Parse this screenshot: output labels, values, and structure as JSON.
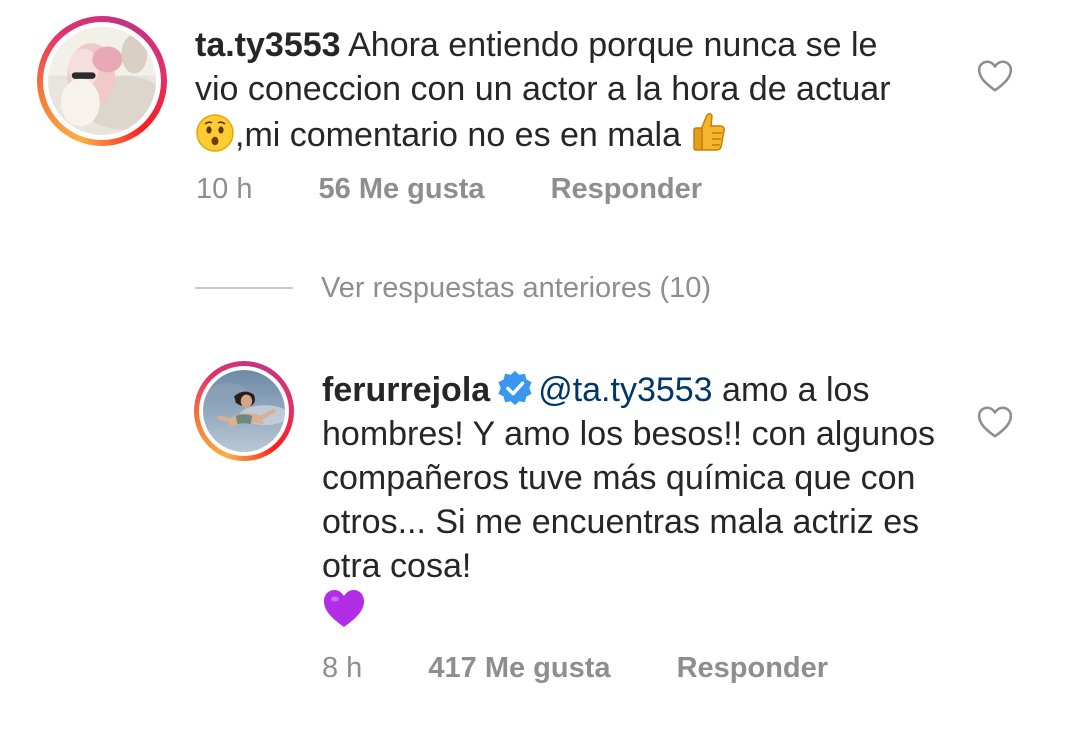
{
  "comments": [
    {
      "username": "ta.ty3553",
      "text_part1": " Ahora entiendo porque nunca se le vio coneccion con un actor a la hora de actuar ",
      "text_part2": ",mi comentario no es en mala ",
      "emoji1": "hushed-face",
      "emoji2": "thumbs-up",
      "time": "10 h",
      "likes": "56 Me gusta",
      "reply": "Responder",
      "liked": false
    },
    {
      "username": "ferurrejola",
      "verified": true,
      "mention": "@ta.ty3553",
      "text": " amo a los hombres! Y amo los besos!! con algunos compañeros tuve más química que con otros... Si me encuentras mala actriz es otra cosa!",
      "emoji": "purple-heart",
      "time": "8 h",
      "likes": "417 Me gusta",
      "reply": "Responder",
      "liked": false
    }
  ],
  "view_replies_label": "Ver respuestas anteriores (10)",
  "colors": {
    "text": "#262626",
    "secondary": "#8e8e8e",
    "mention": "#00376b",
    "verified": "#3897f0",
    "divider": "#c7c7c7"
  }
}
